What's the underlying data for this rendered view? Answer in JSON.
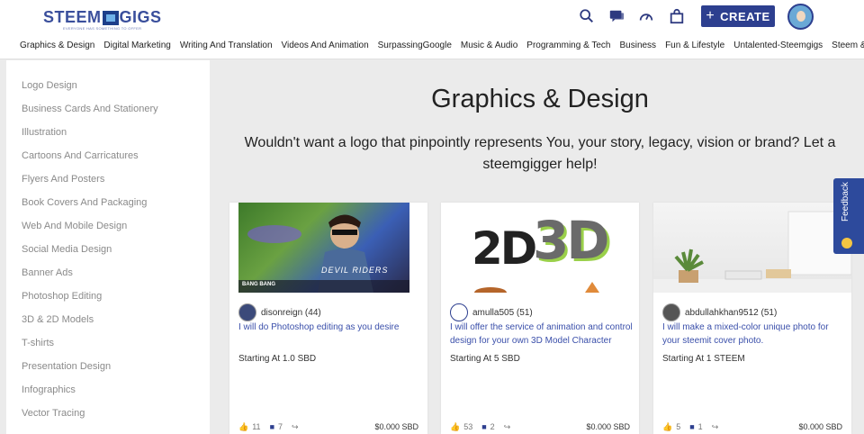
{
  "header": {
    "logo_left": "STEEM",
    "logo_right": "GIGS",
    "logo_tagline": "EVERYONE HAS SOMETHING TO OFFER",
    "icons": [
      "search-icon",
      "chat-icon",
      "dashboard-icon",
      "bag-icon"
    ],
    "create_label": "CREATE"
  },
  "categories": [
    "Graphics & Design",
    "Digital Marketing",
    "Writing And Translation",
    "Videos And Animation",
    "SurpassingGoogle",
    "Music & Audio",
    "Programming & Tech",
    "Business",
    "Fun & Lifestyle",
    "Untalented-Steemgigs",
    "Steem & Steemit"
  ],
  "sidebar": {
    "items": [
      "Logo Design",
      "Business Cards And Stationery",
      "Illustration",
      "Cartoons And Carricatures",
      "Flyers And Posters",
      "Book Covers And Packaging",
      "Web And Mobile Design",
      "Social Media Design",
      "Banner Ads",
      "Photoshop Editing",
      "3D & 2D Models",
      "T-shirts",
      "Presentation Design",
      "Infographics",
      "Vector Tracing"
    ]
  },
  "main": {
    "title": "Graphics & Design",
    "subtitle": "Wouldn't want a logo that pinpointly represents You, your story, legacy, vision or brand? Let a steemgigger help!"
  },
  "cards": [
    {
      "username": "disonreign (44)",
      "description": "I will do Photoshop editing as you desire",
      "price": "Starting At 1.0 SBD",
      "likes": "11",
      "comments": "7",
      "earnings": "$0.000 SBD",
      "image_text": "DEVIL RIDERS",
      "image_text2": "BANG BANG"
    },
    {
      "username": "amulla505 (51)",
      "description": "I will offer the service of animation and control design for your own 3D Model Character",
      "price": "Starting At 5 SBD",
      "likes": "53",
      "comments": "2",
      "earnings": "$0.000 SBD",
      "image_text": "2D",
      "image_text2": "3D"
    },
    {
      "username": "abdullahkhan9512 (51)",
      "description": "I will make a mixed-color unique photo for your steemit cover photo.",
      "price": "Starting At 1 STEEM",
      "likes": "5",
      "comments": "1",
      "earnings": "$0.000 SBD"
    }
  ],
  "feedback": {
    "label": "Feedback"
  },
  "colors": {
    "brand": "#2d3f8f",
    "link": "#3a4faa",
    "background": "#ebebeb"
  }
}
